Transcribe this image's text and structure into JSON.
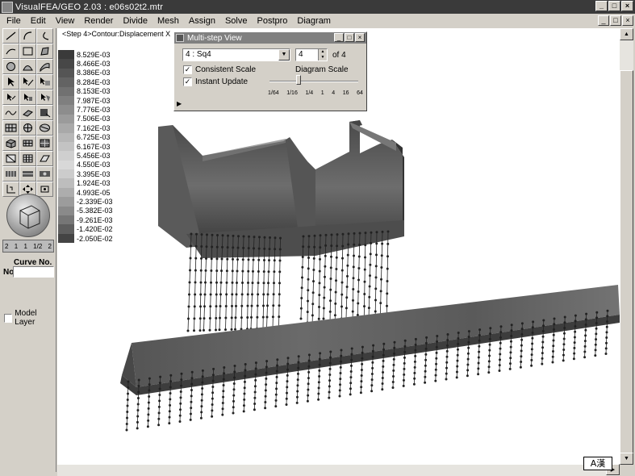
{
  "window": {
    "title": "VisualFEA/GEO 2.03 : e06s02t2.mtr",
    "minimize": "_",
    "maximize": "□",
    "close": "×"
  },
  "menu": [
    "File",
    "Edit",
    "View",
    "Render",
    "Divide",
    "Mesh",
    "Assign",
    "Solve",
    "Postpro",
    "Diagram"
  ],
  "doc_controls": {
    "minimize": "_",
    "restore": "□",
    "close": "×"
  },
  "toolbar": {
    "scale_marks": [
      "2",
      "1",
      "1",
      "1/2",
      "2"
    ],
    "curve_label": "Curve No.",
    "no_label": "No",
    "no_value": "",
    "model_layer_label": "Model Layer",
    "model_layer_checked": false
  },
  "canvas": {
    "step_label": "<Step 4>Contour:Displacement X"
  },
  "legend": [
    {
      "value": "8.529E-03",
      "color": "#3a3a3a"
    },
    {
      "value": "8.466E-03",
      "color": "#474747"
    },
    {
      "value": "8.386E-03",
      "color": "#555555"
    },
    {
      "value": "8.284E-03",
      "color": "#636363"
    },
    {
      "value": "8.153E-03",
      "color": "#717171"
    },
    {
      "value": "7.987E-03",
      "color": "#7f7f7f"
    },
    {
      "value": "7.776E-03",
      "color": "#8d8d8d"
    },
    {
      "value": "7.506E-03",
      "color": "#9b9b9b"
    },
    {
      "value": "7.162E-03",
      "color": "#a9a9a9"
    },
    {
      "value": "6.725E-03",
      "color": "#b7b7b7"
    },
    {
      "value": "6.167E-03",
      "color": "#c3c3c3"
    },
    {
      "value": "5.456E-03",
      "color": "#cfcfcf"
    },
    {
      "value": "4.550E-03",
      "color": "#d8d8d8"
    },
    {
      "value": "3.395E-03",
      "color": "#cccccc"
    },
    {
      "value": "1.924E-03",
      "color": "#bdbdbd"
    },
    {
      "value": "4.993E-05",
      "color": "#adadad"
    },
    {
      "value": "-2.339E-03",
      "color": "#9c9c9c"
    },
    {
      "value": "-5.382E-03",
      "color": "#8a8a8a"
    },
    {
      "value": "-9.261E-03",
      "color": "#767676"
    },
    {
      "value": "-1.420E-02",
      "color": "#5e5e5e"
    },
    {
      "value": "-2.050E-02",
      "color": "#444444"
    }
  ],
  "dialog": {
    "title": "Multi-step View",
    "step_selected": "4 : Sq4",
    "step_number": "4",
    "of_label": "of 4",
    "consistent_scale_label": "Consistent Scale",
    "consistent_scale_checked": true,
    "instant_update_label": "Instant Update",
    "instant_update_checked": true,
    "diagram_scale_label": "Diagram Scale",
    "scale_ticks": [
      "1/64",
      "1/16",
      "1/4",
      "1",
      "4",
      "16",
      "64"
    ]
  },
  "ime_indicator": "A漢"
}
